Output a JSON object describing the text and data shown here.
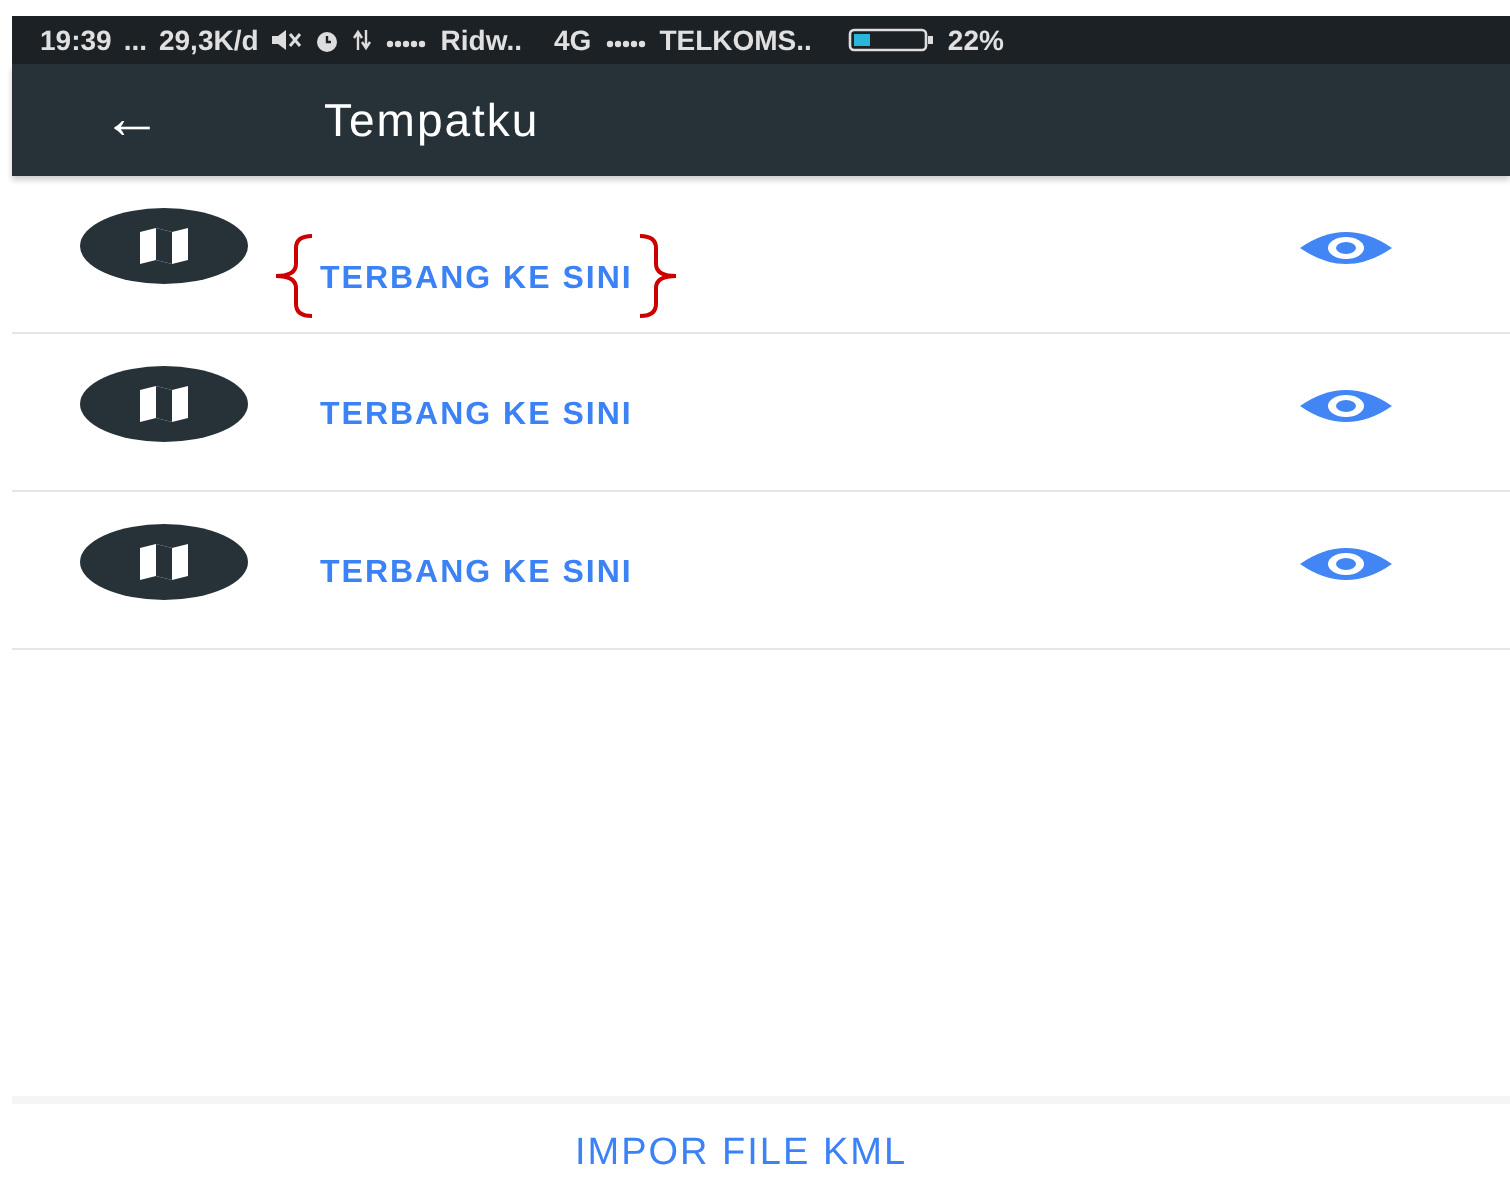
{
  "status_bar": {
    "time": "19:39",
    "dots": "...",
    "speed": "29,3K/d",
    "carrier_1": "Ridw..",
    "network": "4G",
    "carrier_2": "TELKOMS..",
    "battery": "22%"
  },
  "app_bar": {
    "back": "←",
    "title": "Tempatku"
  },
  "places": [
    {
      "action": "TERBANG KE SINI",
      "annotated": true
    },
    {
      "action": "TERBANG KE SINI",
      "annotated": false
    },
    {
      "action": "TERBANG KE SINI",
      "annotated": false
    }
  ],
  "footer": {
    "button": "IMPOR FILE KML"
  }
}
